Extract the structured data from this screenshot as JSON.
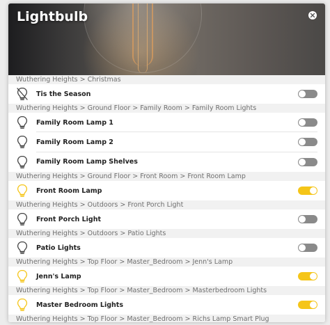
{
  "dialog": {
    "title": "Lightbulb",
    "close_icon": "close-icon"
  },
  "colors": {
    "accent_on": "#f5c518",
    "toggle_off": "#8a8a8a",
    "group_header_bg": "#f1f1f1"
  },
  "groups": [
    {
      "path": "Wuthering Heights > Christmas",
      "items": [
        {
          "label": "Tis the Season",
          "icon": "lightbulb-off-icon",
          "state": "off"
        }
      ]
    },
    {
      "path": "Wuthering Heights > Ground Floor > Family Room > Family Room Lights",
      "items": [
        {
          "label": "Family Room Lamp 1",
          "icon": "lightbulb-icon",
          "state": "off"
        },
        {
          "label": "Family Room Lamp 2",
          "icon": "lightbulb-icon",
          "state": "off"
        },
        {
          "label": "Family Room Lamp Shelves",
          "icon": "lightbulb-icon",
          "state": "off"
        }
      ]
    },
    {
      "path": "Wuthering Heights > Ground Floor > Front Room > Front Room Lamp",
      "items": [
        {
          "label": "Front Room Lamp",
          "icon": "lightbulb-icon",
          "state": "on"
        }
      ]
    },
    {
      "path": "Wuthering Heights > Outdoors > Front Porch Light",
      "items": [
        {
          "label": "Front Porch Light",
          "icon": "lightbulb-icon",
          "state": "off"
        }
      ]
    },
    {
      "path": "Wuthering Heights > Outdoors > Patio Lights",
      "items": [
        {
          "label": "Patio Lights",
          "icon": "lightbulb-icon",
          "state": "off"
        }
      ]
    },
    {
      "path": "Wuthering Heights > Top Floor > Master_Bedroom > Jenn's Lamp",
      "items": [
        {
          "label": "Jenn's Lamp",
          "icon": "lightbulb-icon",
          "state": "on"
        }
      ]
    },
    {
      "path": "Wuthering Heights > Top Floor > Master_Bedroom > Masterbedroom Lights",
      "items": [
        {
          "label": "Master Bedroom Lights",
          "icon": "lightbulb-icon",
          "state": "on"
        }
      ]
    },
    {
      "path": "Wuthering Heights > Top Floor > Master_Bedroom > Richs Lamp Smart Plug",
      "items": []
    }
  ]
}
